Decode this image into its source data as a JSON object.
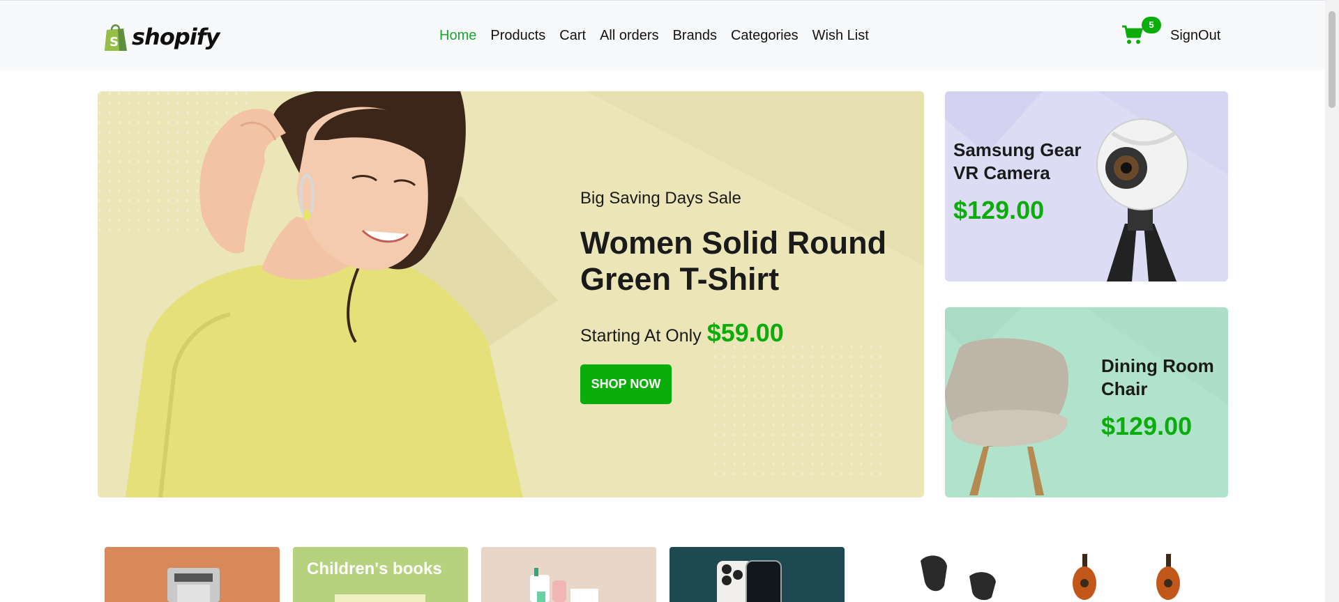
{
  "brand": {
    "name": "shopify",
    "accent": "#0aad0a",
    "nav_active": "#17a72d"
  },
  "nav": {
    "items": [
      {
        "label": "Home",
        "active": true
      },
      {
        "label": "Products",
        "active": false
      },
      {
        "label": "Cart",
        "active": false
      },
      {
        "label": "All orders",
        "active": false
      },
      {
        "label": "Brands",
        "active": false
      },
      {
        "label": "Categories",
        "active": false
      },
      {
        "label": "Wish List",
        "active": false
      }
    ],
    "cart_icon": "cart-icon",
    "cart_count": "5",
    "signout_label": "SignOut"
  },
  "hero": {
    "eyebrow": "Big Saving Days Sale",
    "title": "Women Solid Round Green T-Shirt",
    "starting_label": "Starting At Only",
    "price": "$59.00",
    "button_label": "SHOP NOW",
    "background": "#ebe5b8"
  },
  "side_banners": [
    {
      "title_line1": "Samsung Gear",
      "title_line2": "VR Camera",
      "price": "$129.00",
      "background": "#dcdcf4"
    },
    {
      "title_line1": "Dining Room",
      "title_line2": "Chair",
      "price": "$129.00",
      "background": "#b1e2cc"
    }
  ],
  "categories": [
    {
      "label": ""
    },
    {
      "label": "Children's books"
    },
    {
      "label": ""
    },
    {
      "label": ""
    }
  ]
}
